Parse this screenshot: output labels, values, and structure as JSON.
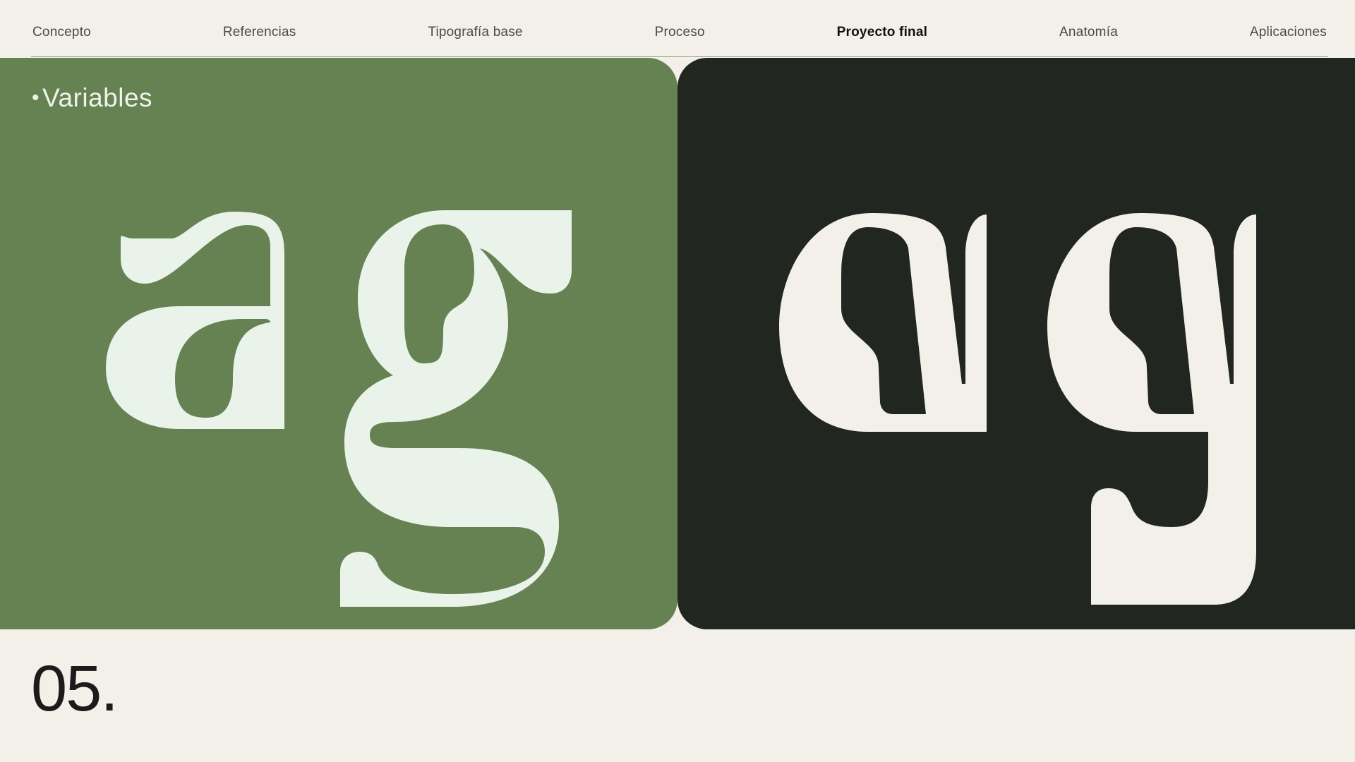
{
  "nav": {
    "items": [
      {
        "label": "Concepto",
        "active": false
      },
      {
        "label": "Referencias",
        "active": false
      },
      {
        "label": "Tipografía base",
        "active": false
      },
      {
        "label": "Proceso",
        "active": false
      },
      {
        "label": "Proyecto final",
        "active": true
      },
      {
        "label": "Anatomía",
        "active": false
      },
      {
        "label": "Aplicaciones",
        "active": false
      }
    ]
  },
  "section": {
    "bullet": "•",
    "label": "Variables"
  },
  "slide": {
    "number": "05."
  },
  "colors": {
    "background": "#f3f0ea",
    "green_panel": "#668253",
    "dark_panel": "#222620",
    "glyph_light": "#eaf3ea",
    "glyph_cream": "#f3f0ea"
  }
}
